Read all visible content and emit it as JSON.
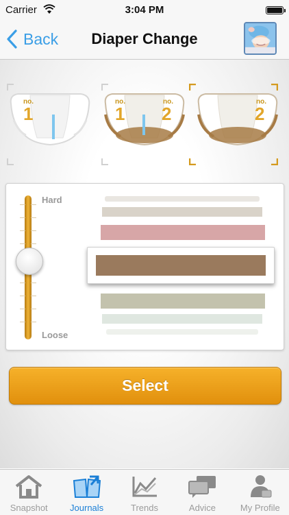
{
  "status_bar": {
    "carrier": "Carrier",
    "time": "3:04 PM"
  },
  "nav": {
    "back_label": "Back",
    "title": "Diaper Change"
  },
  "diapers": [
    {
      "badges": [
        {
          "no": "no.",
          "num": "1"
        }
      ],
      "state": "wet"
    },
    {
      "badges": [
        {
          "no": "no.",
          "num": "1"
        },
        {
          "no": "no.",
          "num": "2"
        }
      ],
      "state": "both"
    },
    {
      "badges": [
        {
          "no": "no.",
          "num": "2"
        }
      ],
      "state": "dirty",
      "selected": true
    }
  ],
  "consistency": {
    "hard_label": "Hard",
    "loose_label": "Loose",
    "slider_level": 0.45,
    "stripe_colors": [
      "#e9e6e1",
      "#d9d3c9",
      "#d7a6a7",
      "#a17e62",
      "#c3c2ad",
      "#dfe7e0"
    ],
    "selected_color": "#9a7a5d"
  },
  "select_button": {
    "label": "Select"
  },
  "tabs": [
    {
      "label": "Snapshot",
      "icon": "home-icon"
    },
    {
      "label": "Journals",
      "icon": "journal-icon",
      "active": true
    },
    {
      "label": "Trends",
      "icon": "trends-icon"
    },
    {
      "label": "Advice",
      "icon": "advice-icon"
    },
    {
      "label": "My Profile",
      "icon": "profile-icon"
    }
  ],
  "colors": {
    "accent": "#3a9ee6",
    "button": "#e9a01c",
    "tab_active": "#1a7fd6"
  }
}
